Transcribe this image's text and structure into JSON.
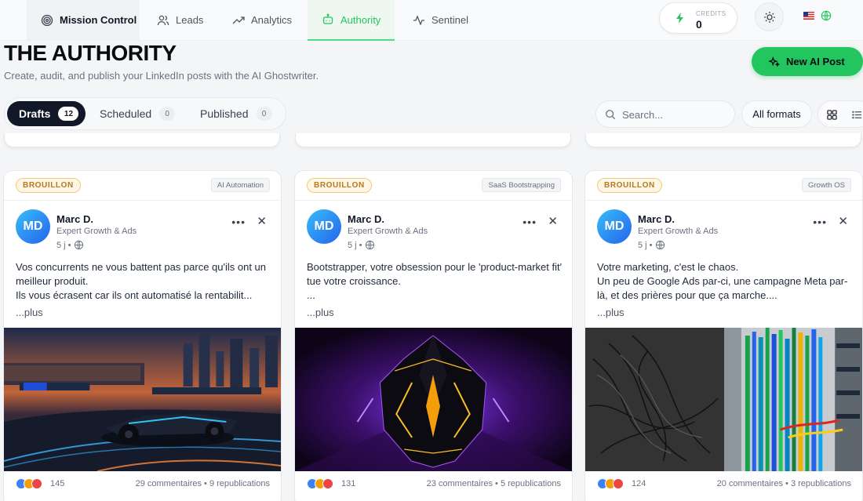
{
  "nav": {
    "tabs": [
      {
        "label": "Mission Control",
        "icon": "target-icon"
      },
      {
        "label": "Leads",
        "icon": "users-icon"
      },
      {
        "label": "Analytics",
        "icon": "trend-up-icon"
      },
      {
        "label": "Authority",
        "icon": "robot-icon",
        "active": true
      },
      {
        "label": "Sentinel",
        "icon": "pulse-icon"
      }
    ],
    "credits_label": "CREDITS",
    "credits_value": "0",
    "accent_color": "#22c55e"
  },
  "header": {
    "title": "THE AUTHORITY",
    "subtitle": "Create, audit, and publish your LinkedIn posts with the AI Ghostwriter.",
    "new_post_label": "New AI Post"
  },
  "status_tabs": [
    {
      "label": "Drafts",
      "count": "12",
      "active": true
    },
    {
      "label": "Scheduled",
      "count": "0"
    },
    {
      "label": "Published",
      "count": "0"
    }
  ],
  "filters": {
    "search_placeholder": "Search...",
    "format_value": "All formats"
  },
  "cards": [
    {
      "badge": "BROUILLON",
      "tag": "AI Automation",
      "avatar": "MD",
      "author": "Marc D.",
      "role": "Expert Growth & Ads",
      "time": "5 j •",
      "text": "Vos concurrents ne vous battent pas parce qu'ils ont un meilleur produit.\nIls vous écrasent car ils ont automatisé la rentabilit...",
      "more": "...plus",
      "image": "race-car-image",
      "reactions": "145",
      "stats": "29 commentaires • 9 republications"
    },
    {
      "badge": "BROUILLON",
      "tag": "SaaS Bootstrapping",
      "avatar": "MD",
      "author": "Marc D.",
      "role": "Expert Growth & Ads",
      "time": "5 j •",
      "text": "Bootstrapper, votre obsession pour le 'product-market fit' tue votre croissance.\n...",
      "more": "...plus",
      "image": "dark-crystal-image",
      "reactions": "131",
      "stats": "23 commentaires • 5 republications"
    },
    {
      "badge": "BROUILLON",
      "tag": "Growth OS",
      "avatar": "MD",
      "author": "Marc D.",
      "role": "Expert Growth & Ads",
      "time": "5 j •",
      "text": "Votre marketing, c'est le chaos.\nUn peu de Google Ads par-ci, une campagne Meta par-là, et des prières pour que ça marche....",
      "more": "...plus",
      "image": "cables-image",
      "reactions": "124",
      "stats": "20 commentaires • 3 republications"
    }
  ]
}
